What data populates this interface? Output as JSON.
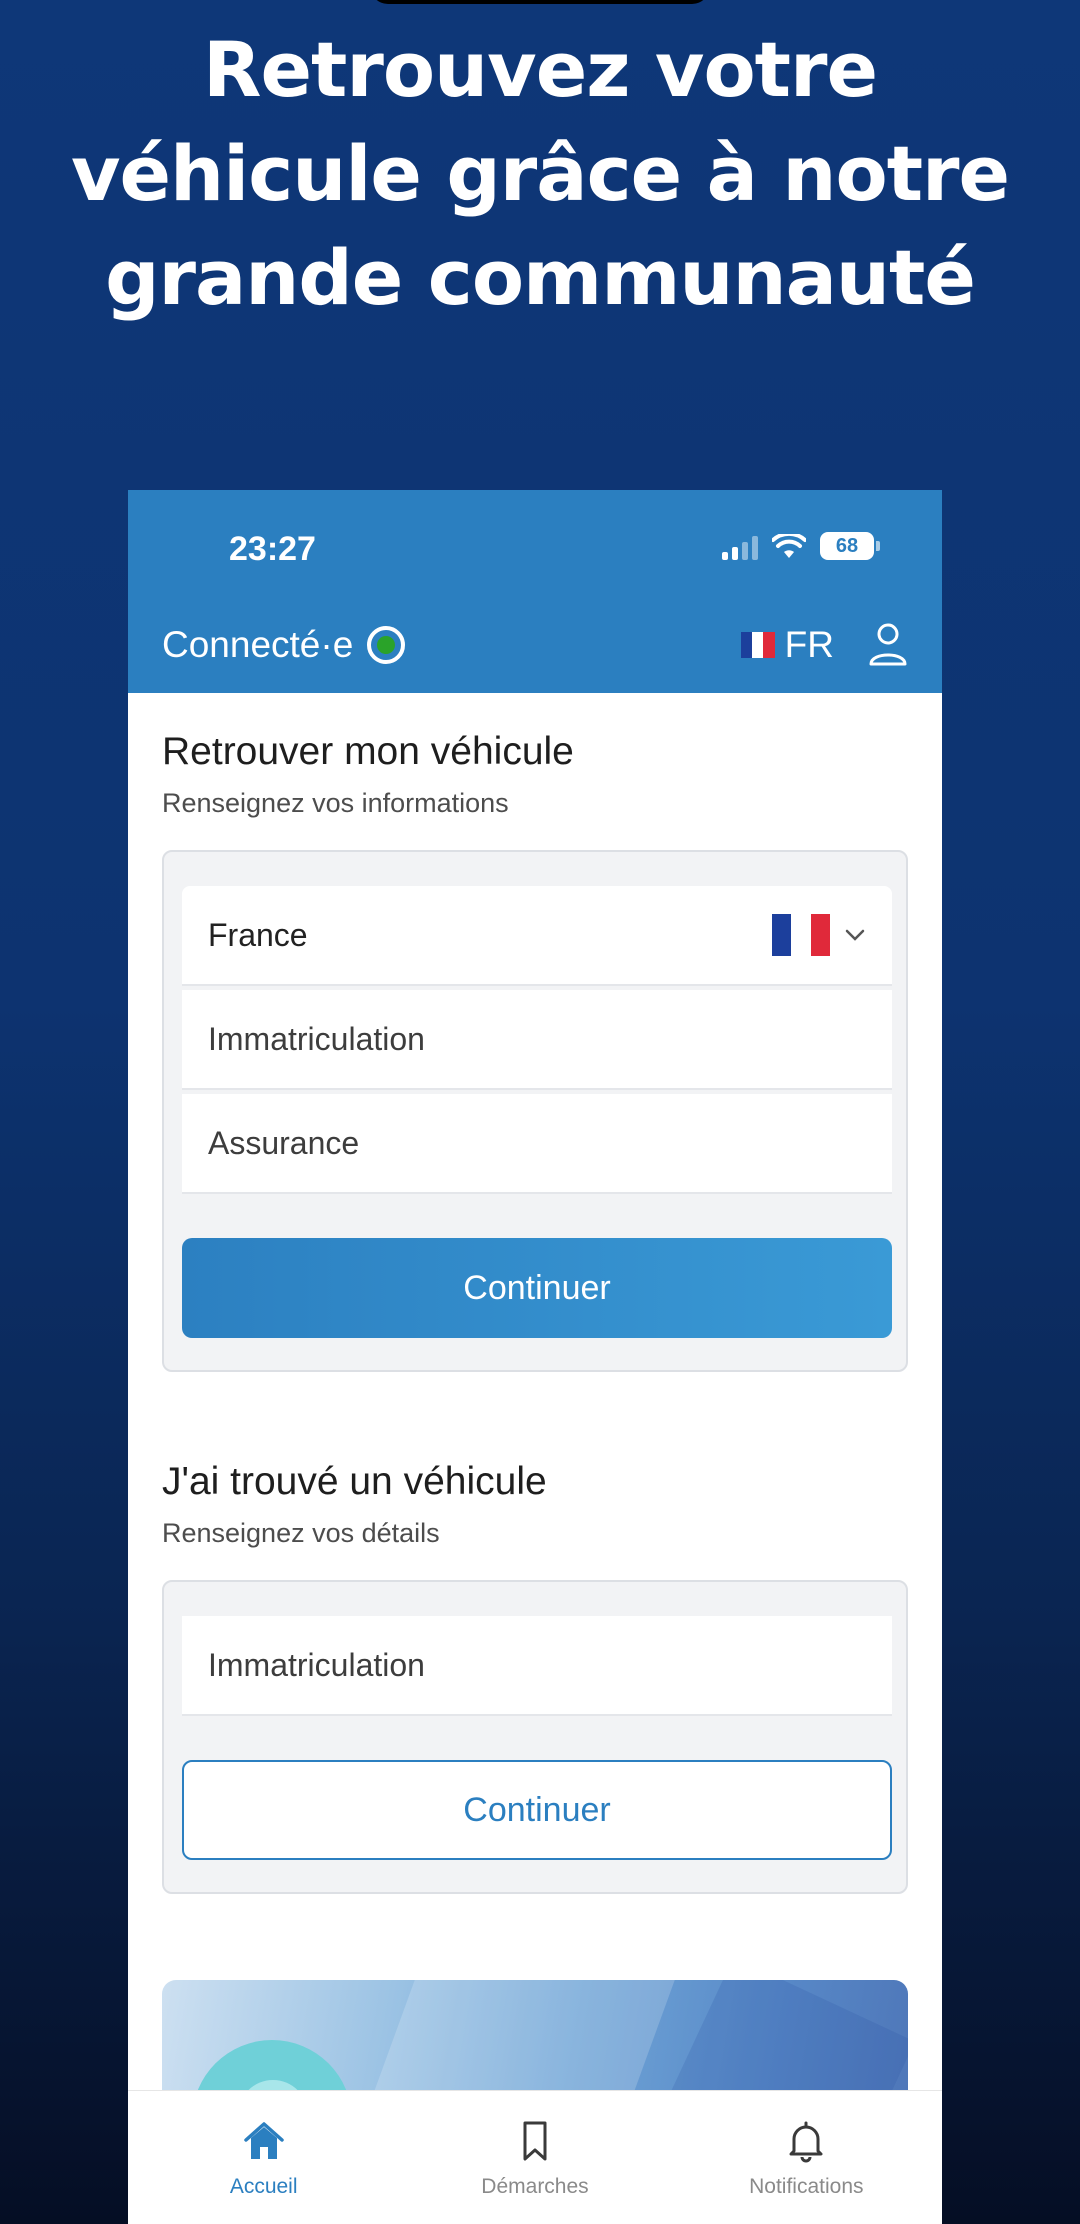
{
  "promo": {
    "line1": "Retrouvez votre",
    "line2": "véhicule grâce à notre",
    "line3": "grande communauté"
  },
  "status_bar": {
    "time": "23:27",
    "battery": "68"
  },
  "header": {
    "connection_label": "Connecté·e",
    "language": "FR",
    "icons": [
      "connected-status-icon",
      "french-flag-icon",
      "profile-icon"
    ]
  },
  "find_section": {
    "title": "Retrouver mon véhicule",
    "subtitle": "Renseignez vos informations",
    "country_value": "France",
    "registration_placeholder": "Immatriculation",
    "insurance_placeholder": "Assurance",
    "button_label": "Continuer"
  },
  "found_section": {
    "title": "J'ai trouvé un véhicule",
    "subtitle": "Renseignez vos détails",
    "registration_placeholder": "Immatriculation",
    "button_label": "Continuer"
  },
  "tabbar": {
    "tabs": [
      {
        "label": "Accueil",
        "icon": "home-icon",
        "active": true
      },
      {
        "label": "Démarches",
        "icon": "bookmark-icon",
        "active": false
      },
      {
        "label": "Notifications",
        "icon": "bell-icon",
        "active": false
      }
    ]
  },
  "colors": {
    "background_top": "#0e3778",
    "background_bottom": "#050e24",
    "header_blue": "#2b7fc0",
    "status_green": "#2aa329",
    "flag_blue": "#1c3f9c",
    "flag_white": "#ffffff",
    "flag_red": "#e0293a"
  }
}
